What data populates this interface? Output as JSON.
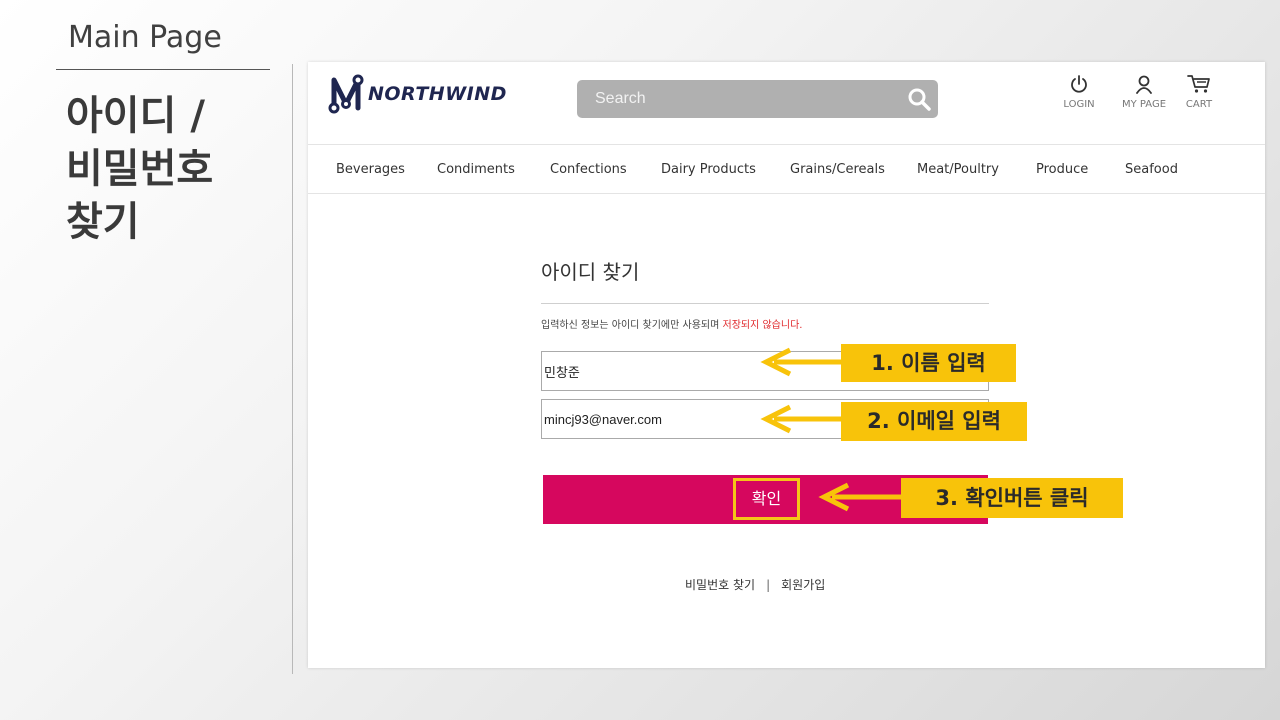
{
  "slide": {
    "title": "Main Page",
    "heading": "아이디 /비밀번호 찾기"
  },
  "site": {
    "logo_text": "NORTHWIND",
    "search": {
      "placeholder": "Search"
    },
    "header_icons": {
      "login": "LOGIN",
      "mypage": "MY PAGE",
      "cart": "CART"
    },
    "nav": [
      "Beverages",
      "Condiments",
      "Confections",
      "Dairy Products",
      "Grains/Cereals",
      "Meat/Poultry",
      "Produce",
      "Seafood"
    ]
  },
  "form": {
    "title": "아이디 찾기",
    "notice": "입력하신 정보는 아이디 찾기에만 사용되며 ",
    "notice_red": "저장되지 않습니다.",
    "name_value": "민창준",
    "email_value": "mincj93@naver.com",
    "confirm_label": "확인",
    "links": {
      "find_password": "비밀번호 찾기",
      "separator": "|",
      "signup": "회원가입"
    }
  },
  "callouts": {
    "step1": "1. 이름 입력",
    "step2": "2. 이메일 입력",
    "step3": "3. 확인버튼 클릭"
  },
  "colors": {
    "accent_button": "#d6075e",
    "callout": "#f8c30a",
    "notice_red": "#e0282b",
    "search_bg": "#b0b0b0"
  }
}
